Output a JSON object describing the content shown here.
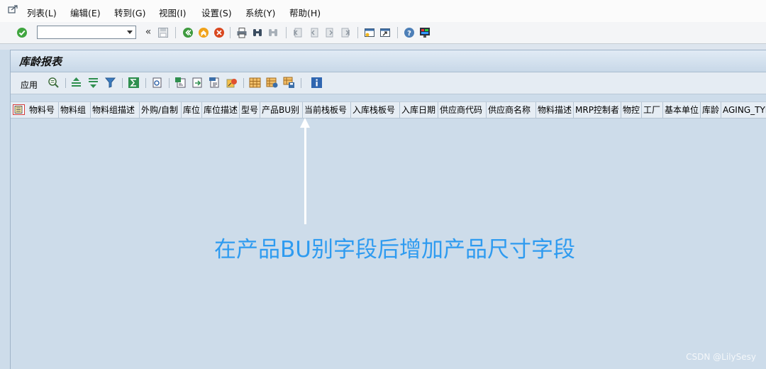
{
  "menu": {
    "items": [
      "列表(L)",
      "编辑(E)",
      "转到(G)",
      "视图(I)",
      "设置(S)",
      "系统(Y)",
      "帮助(H)"
    ]
  },
  "toolbar": {
    "command_value": "",
    "back_nav_label": "«"
  },
  "report": {
    "title": "库龄报表",
    "apply_label": "应用"
  },
  "columns": [
    "物料号",
    "物料组",
    "物料组描述",
    "外购/自制",
    "库位",
    "库位描述",
    "型号",
    "产品BU别",
    "当前栈板号",
    "入库栈板号",
    "入库日期",
    "供应商代码",
    "供应商名称",
    "物料描述",
    "MRP控制者",
    "物控",
    "工厂",
    "基本单位",
    "库龄",
    "AGING_TYPE"
  ],
  "annotation": {
    "text": "在产品BU别字段后增加产品尺寸字段",
    "color": "#2e9bf0"
  },
  "watermark": "CSDN @LilySesy"
}
